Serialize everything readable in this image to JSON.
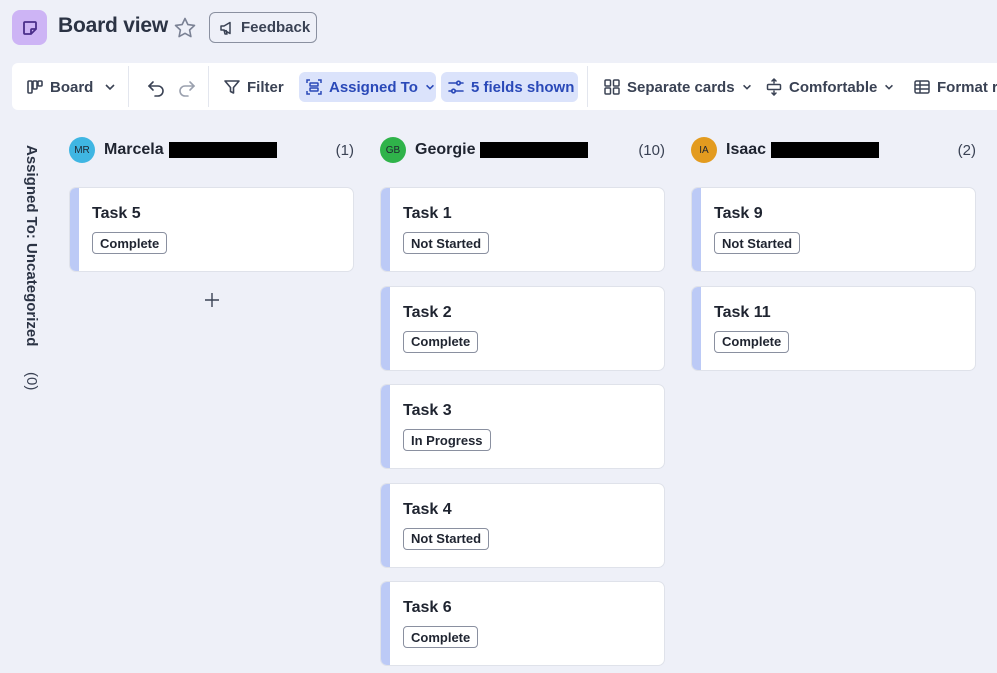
{
  "header": {
    "title": "Board view",
    "feedback_label": "Feedback",
    "app_icon": "note-icon",
    "star_icon": "star-icon"
  },
  "toolbar": {
    "board_label": "Board",
    "filter_label": "Filter",
    "group_label": "Assigned To",
    "fields_label": "5 fields shown",
    "cards_label": "Separate cards",
    "density_label": "Comfortable",
    "format_label": "Format r"
  },
  "uncategorized": {
    "label": "Assigned To: Uncategorized",
    "count": "(0)"
  },
  "columns": [
    {
      "initials": "MR",
      "name": "Marcela",
      "count": "(1)",
      "avatar_color": "#3fb6e3",
      "cards": [
        {
          "title": "Task 5",
          "status": "Complete"
        }
      ]
    },
    {
      "initials": "GB",
      "name": "Georgie",
      "count": "(10)",
      "avatar_color": "#2fb34a",
      "cards": [
        {
          "title": "Task 1",
          "status": "Not Started"
        },
        {
          "title": "Task 2",
          "status": "Complete"
        },
        {
          "title": "Task 3",
          "status": "In Progress"
        },
        {
          "title": "Task 4",
          "status": "Not Started"
        },
        {
          "title": "Task 6",
          "status": "Complete"
        }
      ]
    },
    {
      "initials": "IA",
      "name": "Isaac",
      "count": "(2)",
      "avatar_color": "#e39b1f",
      "cards": [
        {
          "title": "Task 9",
          "status": "Not Started"
        },
        {
          "title": "Task 11",
          "status": "Complete"
        }
      ]
    }
  ],
  "colors": {
    "background": "#eef0f8",
    "card_accent": "#bccaf6",
    "active_chip": "#dbe3fb",
    "active_text": "#2a49b8",
    "app_icon_bg": "#cdb4f5"
  }
}
